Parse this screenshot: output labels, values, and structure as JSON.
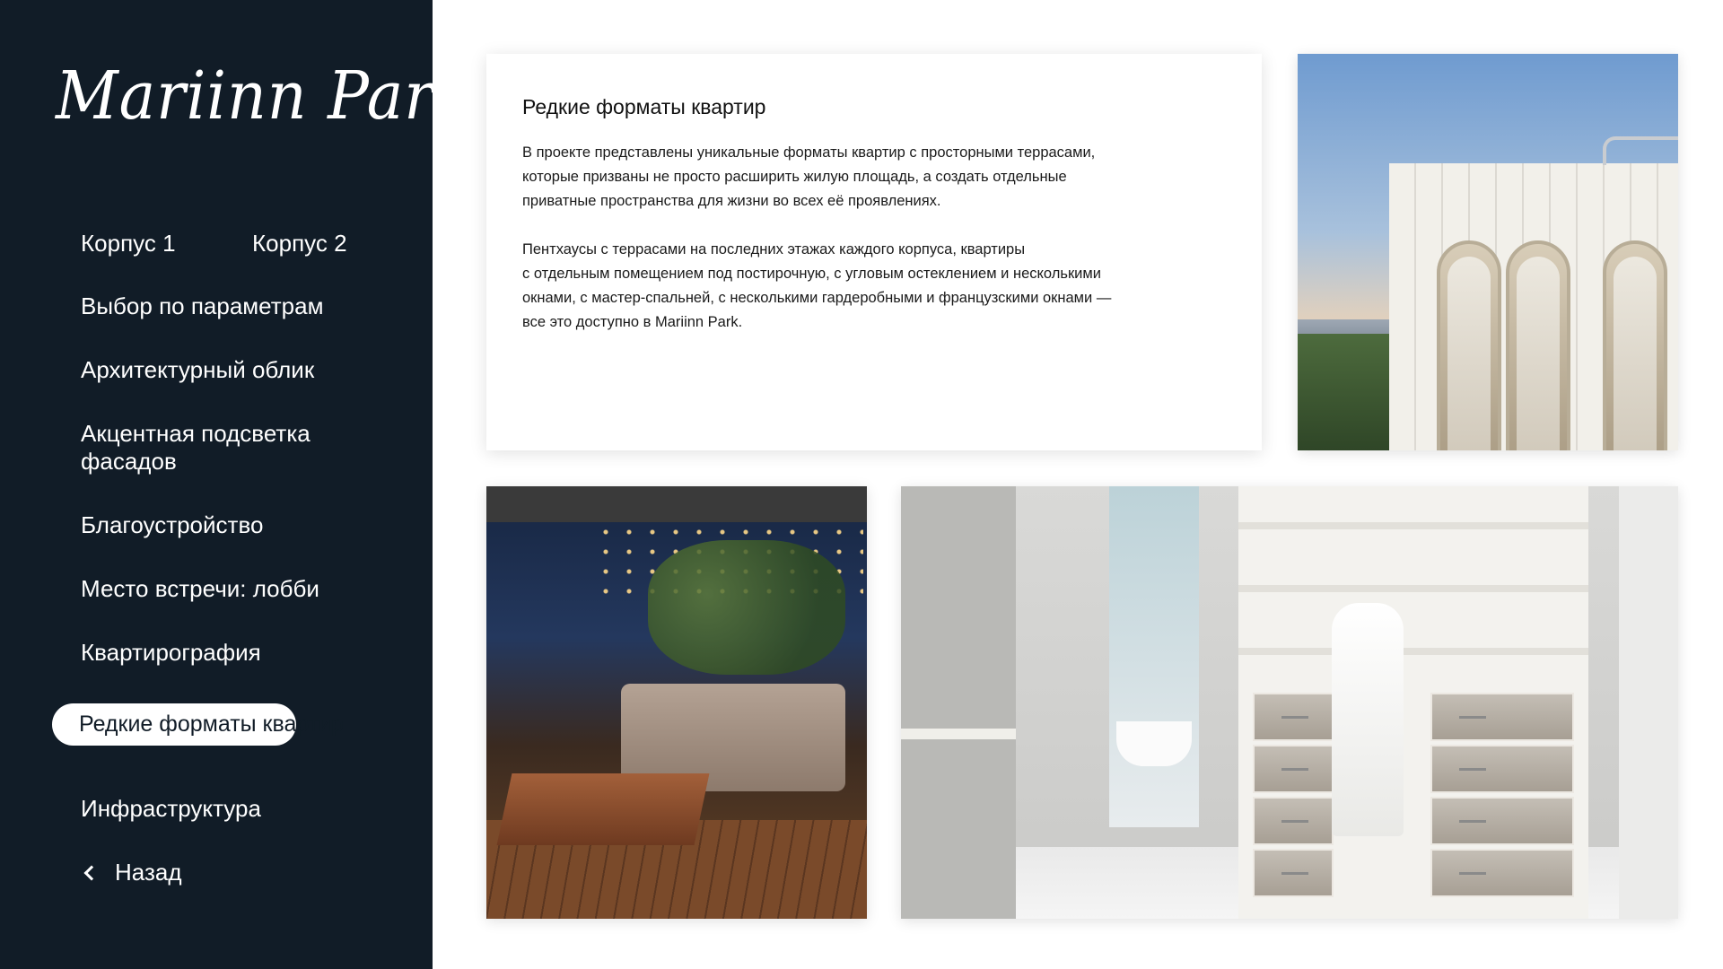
{
  "brand": {
    "logo_text": "Mariinn Park"
  },
  "sidebar": {
    "items": [
      {
        "label": "Корпус 1"
      },
      {
        "label": "Корпус 2"
      },
      {
        "label": "Выбор по параметрам"
      },
      {
        "label": "Архитектурный облик"
      },
      {
        "label": "Акцентная подсветка фасадов"
      },
      {
        "label": "Благоустройство"
      },
      {
        "label": "Место встречи: лобби"
      },
      {
        "label": "Квартирография"
      },
      {
        "label": "Редкие форматы квартир",
        "active": true
      },
      {
        "label": "Инфраструктура"
      }
    ],
    "back": {
      "label": "Назад",
      "icon": "chevron-left-icon"
    }
  },
  "card": {
    "title": "Редкие форматы квартир",
    "paragraphs": [
      "В проекте представлены уникальные форматы квартир с просторными террасами,\nкоторые призваны не просто расширить жилую площадь, а создать отдельные\nприватные пространства для жизни во всех её проявлениях.",
      "Пентхаусы с террасами на последних этажах каждого корпуса, квартиры\nс отдельным помещением под постирочную, с угловым остеклением и несколькими\nокнами, с мастер-спальней, с несколькими гардеробными и французскими окнами —\nвсе это доступно в Mariinn Park."
    ]
  },
  "colors": {
    "sidebar_bg": "#111c27",
    "text_light": "#ffffff",
    "active_bg": "#ffffff"
  }
}
